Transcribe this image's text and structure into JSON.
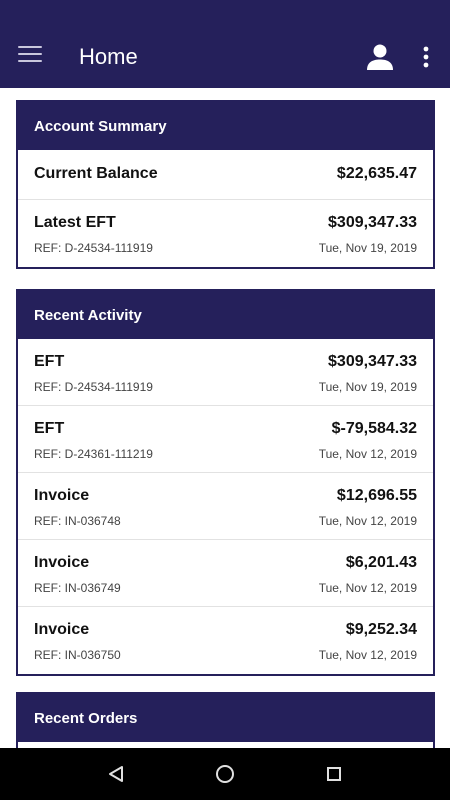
{
  "app_bar": {
    "title": "Home",
    "background": "#25205b"
  },
  "account_summary": {
    "title": "Account Summary",
    "current_balance": {
      "label": "Current Balance",
      "amount": "$22,635.47"
    },
    "latest_eft": {
      "label": "Latest EFT",
      "amount": "$309,347.33",
      "ref": "REF: D-24534-111919",
      "date": "Tue, Nov 19, 2019"
    }
  },
  "recent_activity": {
    "title": "Recent Activity",
    "items": [
      {
        "label": "EFT",
        "amount": "$309,347.33",
        "ref": "REF: D-24534-111919",
        "date": "Tue, Nov 19, 2019"
      },
      {
        "label": "EFT",
        "amount": "$-79,584.32",
        "ref": "REF: D-24361-111219",
        "date": "Tue, Nov 12, 2019"
      },
      {
        "label": "Invoice",
        "amount": "$12,696.55",
        "ref": "REF: IN-036748",
        "date": "Tue, Nov 12, 2019"
      },
      {
        "label": "Invoice",
        "amount": "$6,201.43",
        "ref": "REF: IN-036749",
        "date": "Tue, Nov 12, 2019"
      },
      {
        "label": "Invoice",
        "amount": "$9,252.34",
        "ref": "REF: IN-036750",
        "date": "Tue, Nov 12, 2019"
      }
    ]
  },
  "recent_orders": {
    "title": "Recent Orders"
  },
  "icons": {
    "menu": "hamburger-menu-icon",
    "profile": "person-icon",
    "more": "more-vertical-icon",
    "back": "triangle-back-icon",
    "home": "circle-home-icon",
    "recents": "square-recents-icon"
  }
}
